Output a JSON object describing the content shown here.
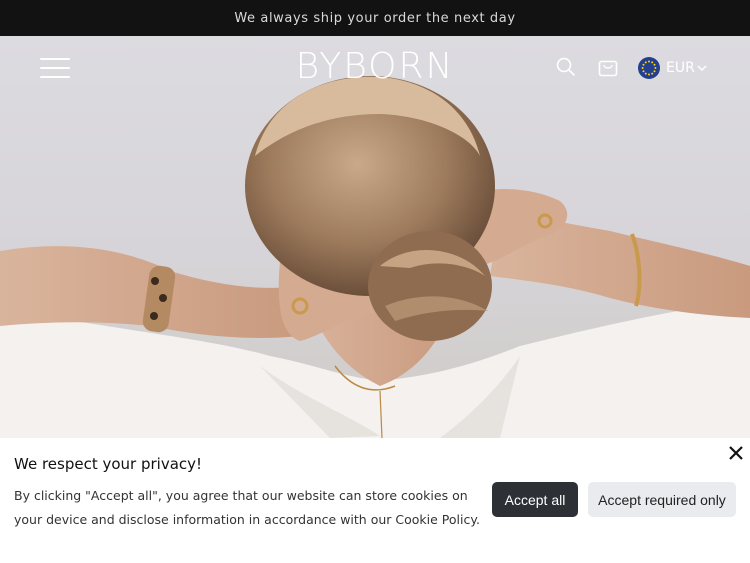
{
  "announcement": {
    "text": "We always ship your order the next day"
  },
  "header": {
    "logo_text": "BYBORN",
    "currency_label": "EUR",
    "icons": [
      "menu-icon",
      "search-icon",
      "cart-icon",
      "eu-flag-icon",
      "chevron-down-icon"
    ]
  },
  "hero": {
    "image": "woman-with-hair-bun-and-bracelets"
  },
  "cookie_banner": {
    "title": "We respect your privacy!",
    "text": "By clicking \"Accept all\", you agree that our website can store cookies on your device and disclose information in accordance with our Cookie Policy.",
    "accept_all_label": "Accept all",
    "accept_required_label": "Accept required only",
    "close_icon": "close-icon"
  },
  "colors": {
    "announcement_bg": "#121212",
    "accept_button_bg": "#2d3035",
    "secondary_button_bg": "#e9ebee"
  }
}
